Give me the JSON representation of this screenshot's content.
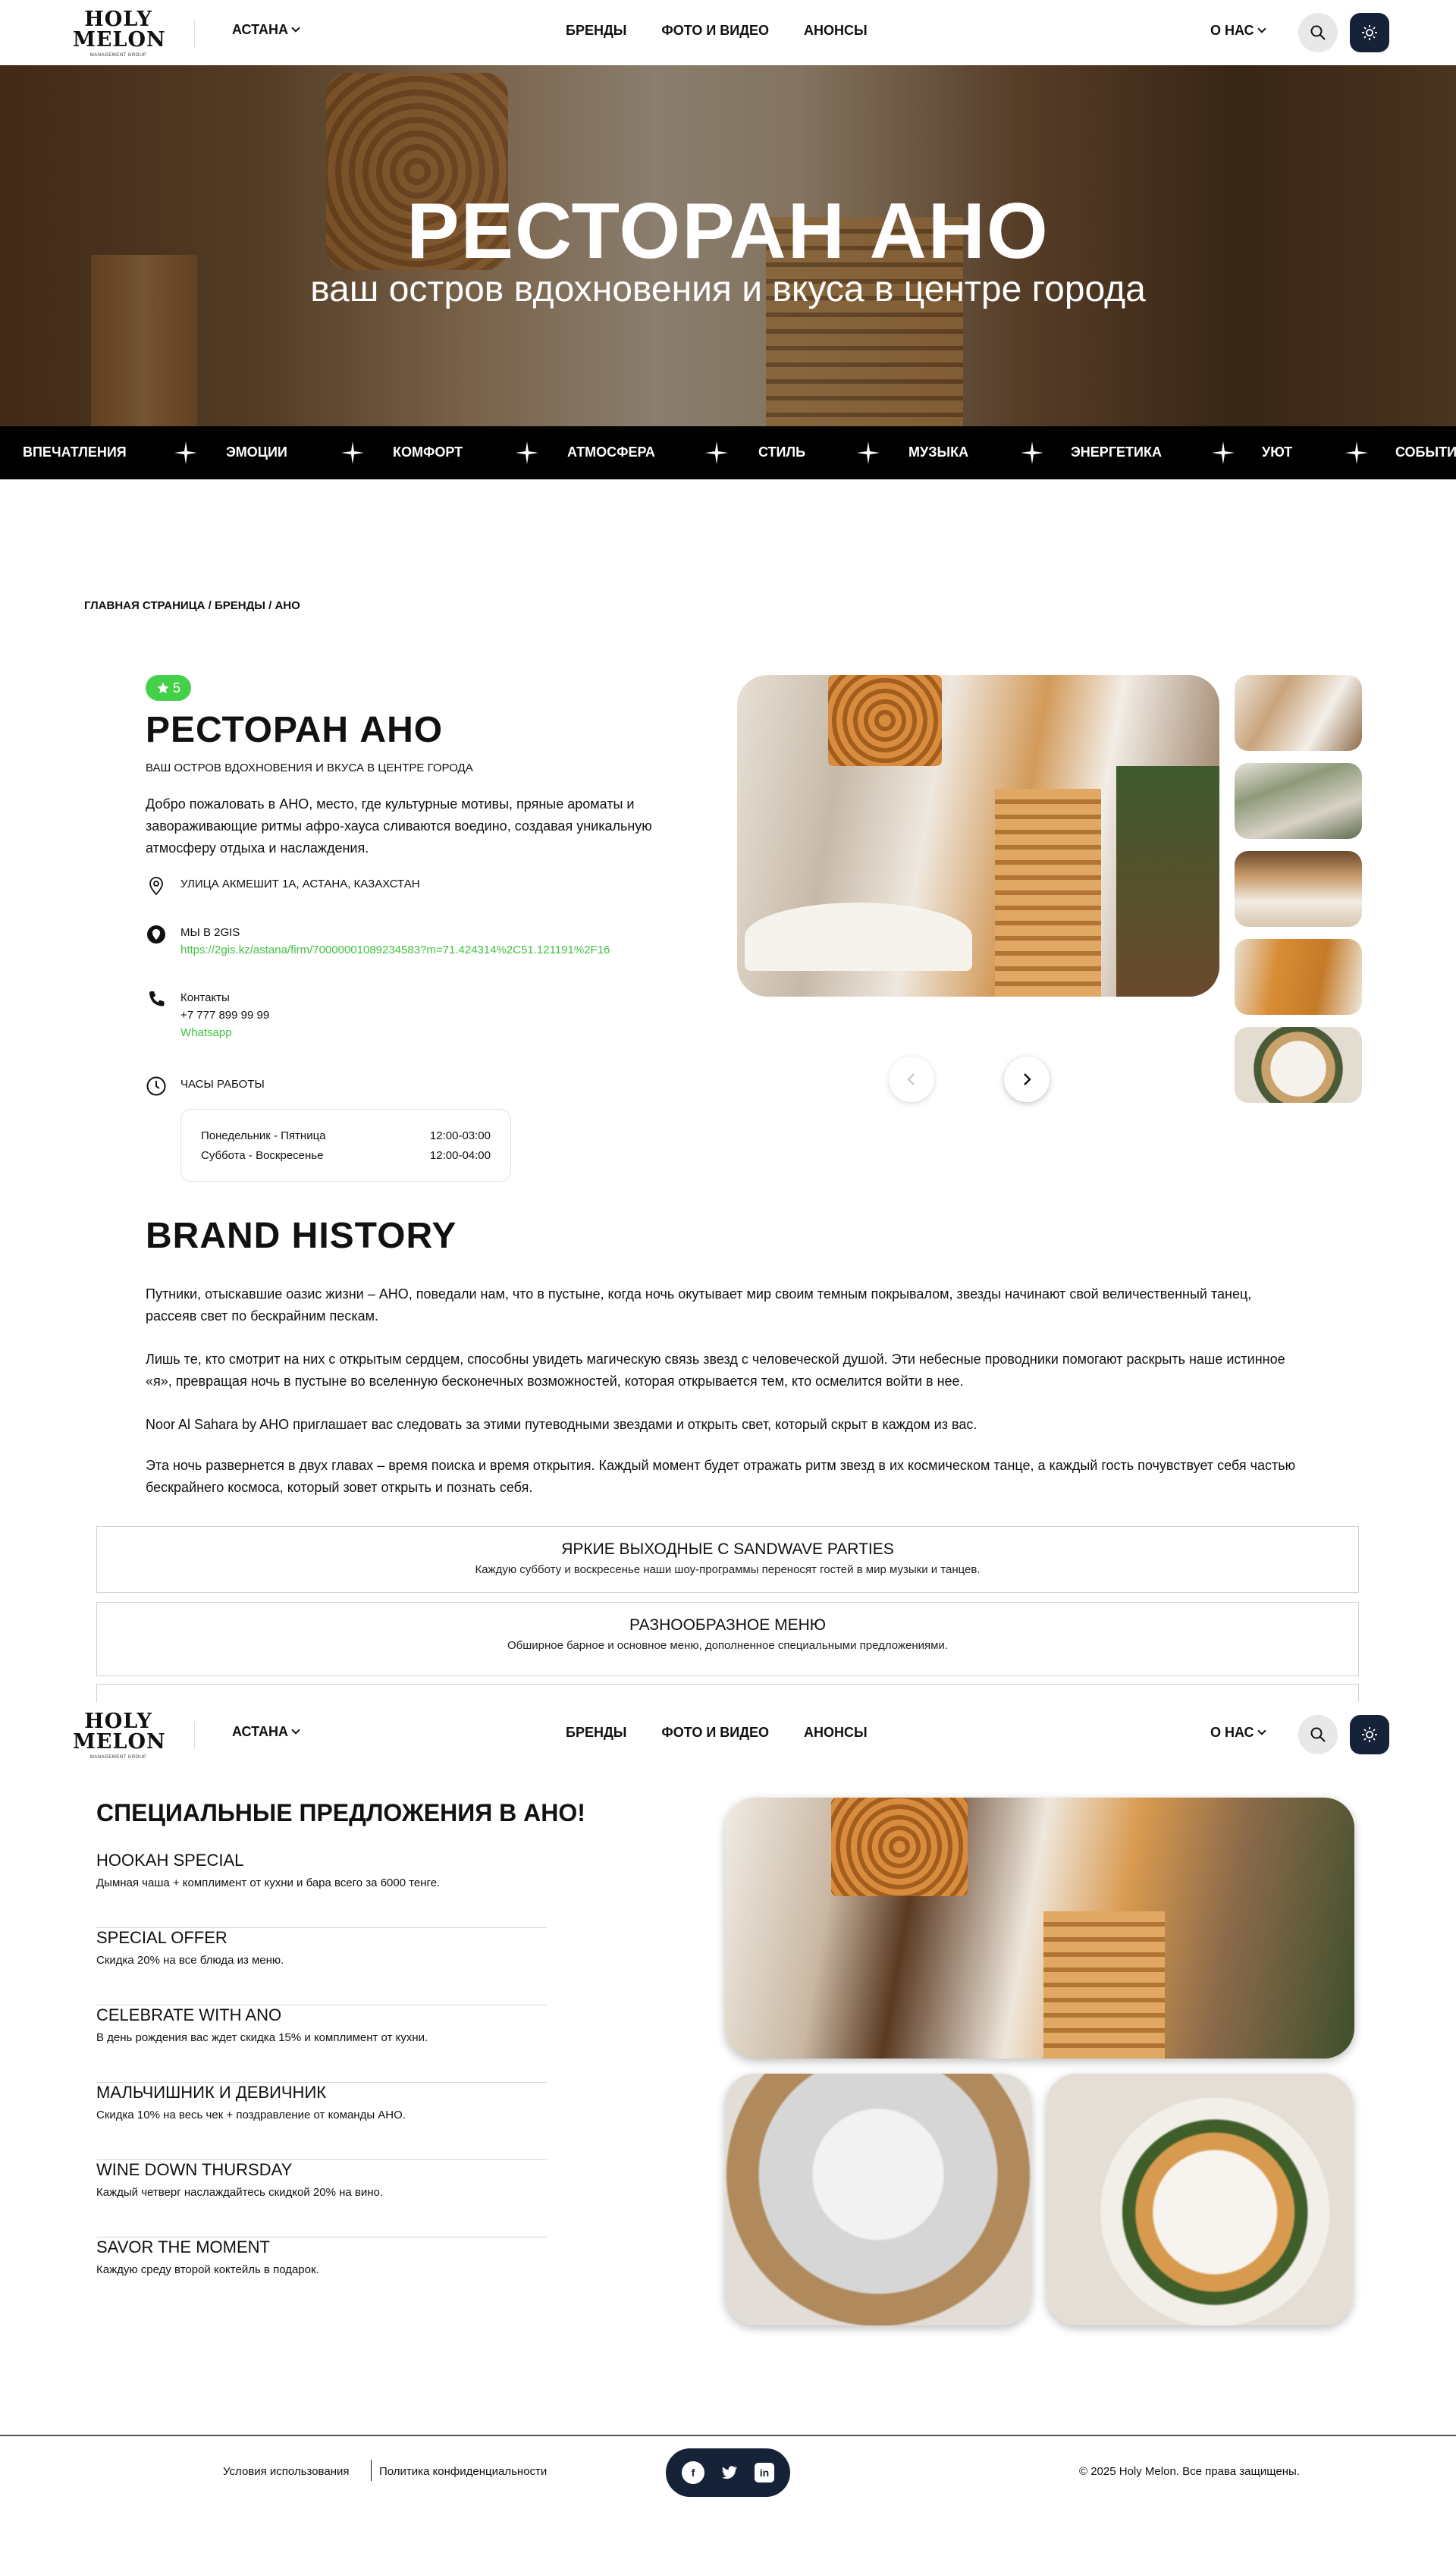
{
  "header": {
    "logo_line1": "HOLY",
    "logo_line2": "MELON",
    "logo_caption": "MANAGEMENT GROUP",
    "city": "АСТАНА",
    "nav": [
      "БРЕНДЫ",
      "ФОТО И ВИДЕО",
      "АНОНСЫ"
    ],
    "about": "О НАС",
    "icons": [
      "search-icon",
      "sun-icon",
      "chevron-down-icon"
    ]
  },
  "hero": {
    "title": "РЕСТОРАН АНО",
    "subtitle": "ваш остров вдохновения и вкуса в центре города"
  },
  "ticker": [
    "ВПЕЧАТЛЕНИЯ",
    "ЭМОЦИИ",
    "КОМФОРТ",
    "АТМОСФЕРА",
    "СТИЛЬ",
    "МУЗЫКА",
    "ЭНЕРГЕТИКА",
    "УЮТ",
    "СОБЫТИЯ"
  ],
  "breadcrumb": "ГЛАВНАЯ СТРАНИЦА / БРЕНДЫ / АНО",
  "brand": {
    "rating": "5",
    "title": "РЕСТОРАН АНО",
    "subtitle": "ВАШ ОСТРОВ ВДОХНОВЕНИЯ И ВКУСА В ЦЕНТРЕ ГОРОДА",
    "intro": "Добро пожаловать в АНО, место, где культурные мотивы, пряные ароматы и завораживающие ритмы афро-хауса сливаются воедино, создавая уникальную атмосферу отдыха и наслаждения.",
    "address": "УЛИЦА АКМЕШИТ 1А, АСТАНА, КАЗАХСТАН",
    "gis_label": "МЫ В 2GIS",
    "gis_link": "https://2gis.kz/astana/firm/70000001089234583?m=71.424314%2C51.121191%2F16",
    "contacts_label": "Контакты",
    "phone": "+7 777 899 99 99",
    "whatsapp": "Whatsapp",
    "hours_label": "ЧАСЫ РАБОТЫ",
    "hours": [
      {
        "days": "Понедельник - Пятница",
        "time": "12:00-03:00"
      },
      {
        "days": "Суббота - Воскресенье",
        "time": "12:00-04:00"
      }
    ]
  },
  "history": {
    "title": "BRAND HISTORY",
    "paragraphs": [
      "Путники, отыскавшие оазис жизни – АНО, поведали нам, что в пустыне, когда ночь окутывает мир своим темным покрывалом, звезды начинают свой величественный танец, рассеяв свет по бескрайним пескам.",
      "Лишь те, кто смотрит на них с открытым сердцем, способны увидеть магическую связь звезд с человеческой душой. Эти небесные проводники помогают раскрыть наше истинное «я», превращая ночь в пустыне во вселенную бесконечных возможностей, которая открывается тем, кто осмелится войти в нее.",
      "Noor Al Sahara by AHO приглашает вас следовать за этими путеводными звездами и открыть свет, который скрыт в каждом из вас.",
      "Эта ночь развернется в двух главах – время поиска и время открытия. Каждый момент будет отражать ритм звезд в их космическом танце, а каждый гость почувствует себя частью бескрайнего космоса, который зовет открыть и познать себя."
    ]
  },
  "features": [
    {
      "title": "ЯРКИЕ ВЫХОДНЫЕ С SANDWAVE PARTIES",
      "desc": "Каждую субботу и воскресенье наши шоу-программы переносят гостей в мир музыки и танцев."
    },
    {
      "title": "РАЗНООБРАЗНОЕ МЕНЮ",
      "desc": "Обширное барное и основное меню, дополненное специальными предложениями."
    }
  ],
  "offers": {
    "title": "СПЕЦИАЛЬНЫЕ ПРЕДЛОЖЕНИЯ В АНО!",
    "items": [
      {
        "title": "HOOKAH SPECIAL",
        "desc": "Дымная чаша + комплимент от кухни и бара всего за 6000 тенге."
      },
      {
        "title": "SPECIAL OFFER",
        "desc": "Скидка 20% на все блюда из меню."
      },
      {
        "title": "CELEBRATE WITH ANO",
        "desc": "В день рождения вас ждет скидка 15% и комплимент от кухни."
      },
      {
        "title": "МАЛЬЧИШНИК И ДЕВИЧНИК",
        "desc": "Скидка 10% на весь чек + поздравление от команды АНО."
      },
      {
        "title": "WINE DOWN THURSDAY",
        "desc": "Каждый четверг наслаждайтесь скидкой 20% на вино."
      },
      {
        "title": "SAVOR THE MOMENT",
        "desc": "Каждую среду второй коктейль в подарок."
      }
    ]
  },
  "footer": {
    "terms": "Условия использования",
    "privacy": "Политика конфиденциальности",
    "social": [
      "facebook-icon",
      "twitter-icon",
      "linkedin-icon"
    ],
    "copyright": "© 2025 Holy Melon. Все права защищены."
  },
  "colors": {
    "accent_dark": "#152238",
    "rating_green": "#44d04a",
    "link_green": "#3fc23f",
    "ticker_bg": "#000000"
  }
}
